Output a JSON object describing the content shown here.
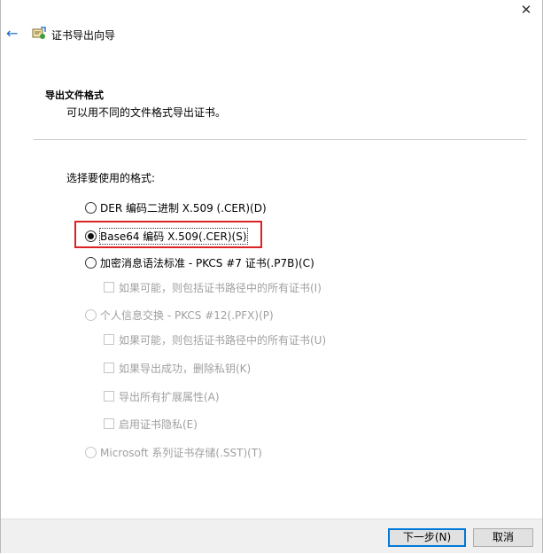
{
  "window": {
    "close_glyph": "✕"
  },
  "header": {
    "back_glyph": "←",
    "title": "证书导出向导",
    "icon": "certificate-wizard-icon"
  },
  "section": {
    "title": "导出文件格式",
    "description": "可以用不同的文件格式导出证书。"
  },
  "formats": {
    "label": "选择要使用的格式:",
    "options": [
      {
        "label": "DER 编码二进制 X.509 (.CER)(D)",
        "checked": false,
        "enabled": true
      },
      {
        "label": "Base64 编码 X.509(.CER)(S)",
        "checked": true,
        "enabled": true
      },
      {
        "label": "加密消息语法标准 - PKCS #7 证书(.P7B)(C)",
        "checked": false,
        "enabled": true
      },
      {
        "label": "个人信息交换 - PKCS #12(.PFX)(P)",
        "checked": false,
        "enabled": false
      },
      {
        "label": "Microsoft 系列证书存储(.SST)(T)",
        "checked": false,
        "enabled": false
      }
    ],
    "pkcs7_include_chain": "如果可能，则包括证书路径中的所有证书(I)",
    "pfx_include_chain": "如果可能，则包括证书路径中的所有证书(U)",
    "pfx_delete_key": "如果导出成功，删除私钥(K)",
    "pfx_export_ext": "导出所有扩展属性(A)",
    "pfx_enable_privacy": "启用证书隐私(E)"
  },
  "footer": {
    "next_label": "下一步(N)",
    "cancel_label": "取消"
  }
}
